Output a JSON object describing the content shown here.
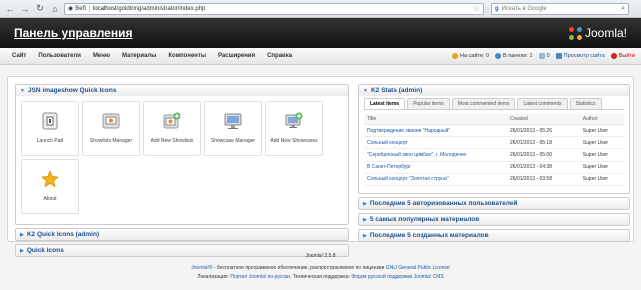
{
  "browser": {
    "address_chip": "Веб",
    "url_host": "localhost",
    "url_path": "/goldtring/administrator/index.php",
    "search_placeholder": "Искать в Google"
  },
  "header": {
    "title": "Панель управления",
    "logo_text": "Joomla!"
  },
  "menu": {
    "items": [
      "Сайт",
      "Пользователи",
      "Меню",
      "Материалы",
      "Компоненты",
      "Расширения",
      "Справка"
    ],
    "status": {
      "on_site": "На сайте: 0",
      "in_panel": "В панели: 1",
      "messages": "0",
      "preview": "Просмотр сайта",
      "logout": "Выйти"
    }
  },
  "left": {
    "imageshow_title": "JSN imageshow Quick Icons",
    "quick_icons": [
      {
        "label": "Launch Pad",
        "icon": "launch-pad-icon"
      },
      {
        "label": "Showlists Manager",
        "icon": "showlists-manager-icon"
      },
      {
        "label": "Add New Showlists",
        "icon": "add-showlist-icon"
      },
      {
        "label": "Showcase Manager",
        "icon": "showcase-manager-icon"
      },
      {
        "label": "Add New Showcases",
        "icon": "add-showcase-icon"
      },
      {
        "label": "About",
        "icon": "about-star-icon"
      }
    ],
    "k2_quick_title": "K2 Quick Icons (admin)",
    "quick_icons_title": "Quick Icons"
  },
  "right": {
    "k2_stats_title": "K2 Stats (admin)",
    "tabs": [
      "Latest items",
      "Popular items",
      "Most commented items",
      "Latest comments",
      "Statistics"
    ],
    "table": {
      "headers": [
        "Title",
        "Created",
        "Author"
      ],
      "rows": [
        [
          "Подтверждение звания \"Народный\"",
          "26/01/2013 - 05:26",
          "Super User"
        ],
        [
          "Сольный концерт",
          "26/01/2013 - 05:18",
          "Super User"
        ],
        [
          "\"Серебрянный звон цимбал\", г. Молодечно",
          "26/01/2013 - 05:00",
          "Super User"
        ],
        [
          "В Санкт-Петербург",
          "26/01/2013 - 04:38",
          "Super User"
        ],
        [
          "Сольный концерт \"Золотая струна\"",
          "26/01/2013 - 03:58",
          "Super User"
        ]
      ]
    },
    "panels": [
      "Последние 5 авторизованных пользователей",
      "5 самых популярных материалов",
      "Последние 5 созданных материалов"
    ]
  },
  "footer": {
    "version": "Joomla! 2.5.8",
    "line1_link1": "Joomla!®",
    "line1_text": " - бесплатное программное обеспечение, распространяемое по лицензии ",
    "line1_link2": "GNU General Public License",
    "line2_prefix": "Локализация: ",
    "line2_link1": "Портал Joomla! по-русски",
    "line2_mid": ". Техническая поддержка: ",
    "line2_link2": "Форум русской поддержки Joomla! CMS"
  }
}
